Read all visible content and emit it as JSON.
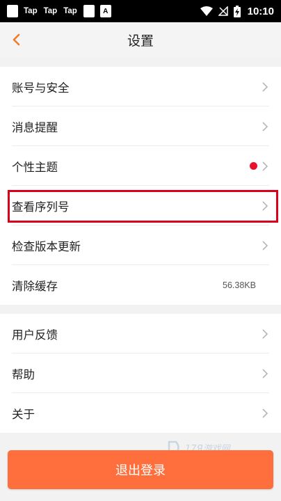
{
  "status_bar": {
    "tap_labels": [
      "Tap",
      "Tap",
      "Tap"
    ],
    "a_badge": "A",
    "time": "10:10"
  },
  "header": {
    "title": "设置",
    "accent_color": "#f07a2c"
  },
  "groups": [
    {
      "items": [
        {
          "label": "账号与安全"
        },
        {
          "label": "消息提醒"
        },
        {
          "label": "个性主题",
          "badge": "red-dot"
        },
        {
          "label": "查看序列号",
          "highlighted": true
        },
        {
          "label": "检查版本更新"
        },
        {
          "label": "清除缓存",
          "value": "56.38KB"
        }
      ]
    },
    {
      "items": [
        {
          "label": "用户反馈"
        },
        {
          "label": "帮助"
        },
        {
          "label": "关于"
        }
      ]
    }
  ],
  "watermark": "17Я游戏网",
  "logout_button": {
    "label": "退出登录",
    "color": "#ff6f3d"
  }
}
